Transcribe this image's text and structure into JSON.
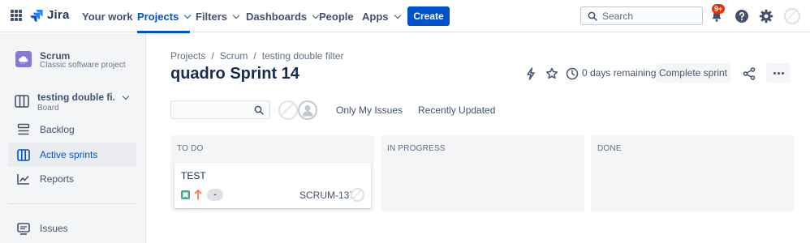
{
  "topnav": {
    "product": "Jira",
    "items": [
      {
        "label": "Your work",
        "dropdown": false,
        "active": false
      },
      {
        "label": "Projects",
        "dropdown": true,
        "active": true
      },
      {
        "label": "Filters",
        "dropdown": true,
        "active": false
      },
      {
        "label": "Dashboards",
        "dropdown": true,
        "active": false
      },
      {
        "label": "People",
        "dropdown": false,
        "active": false
      },
      {
        "label": "Apps",
        "dropdown": true,
        "active": false
      }
    ],
    "create_label": "Create",
    "search_placeholder": "Search",
    "notifications_badge": "9+",
    "icons": [
      "app-switcher-icon",
      "jira-logo-icon",
      "search-icon",
      "bell-icon",
      "help-icon",
      "settings-icon",
      "avatar"
    ]
  },
  "sidebar": {
    "project_name": "Scrum",
    "project_type": "Classic software project",
    "board_name": "testing double fi...",
    "board_sub": "Board",
    "items": [
      {
        "label": "Backlog",
        "icon": "backlog-icon",
        "active": false
      },
      {
        "label": "Active sprints",
        "icon": "board-icon",
        "active": true
      },
      {
        "label": "Reports",
        "icon": "reports-icon",
        "active": false
      },
      {
        "label": "Issues",
        "icon": "issues-icon",
        "active": false
      }
    ]
  },
  "main": {
    "breadcrumb": [
      "Projects",
      "Scrum",
      "testing double filter"
    ],
    "title": "quadro Sprint 14",
    "days_remaining": "0 days remaining",
    "complete_sprint_label": "Complete sprint",
    "board_search_value": "",
    "quick_filters": [
      "Only My Issues",
      "Recently Updated"
    ],
    "columns": [
      "TO DO",
      "IN PROGRESS",
      "DONE"
    ],
    "card": {
      "title": "TEST",
      "estimate": "-",
      "key": "SCRUM-137"
    }
  },
  "colors": {
    "accent": "#0052cc",
    "sidebar_bg": "#f4f5f7",
    "story_green": "#36b37e",
    "priority_orange": "#ff7452",
    "badge_red": "#de350b"
  }
}
